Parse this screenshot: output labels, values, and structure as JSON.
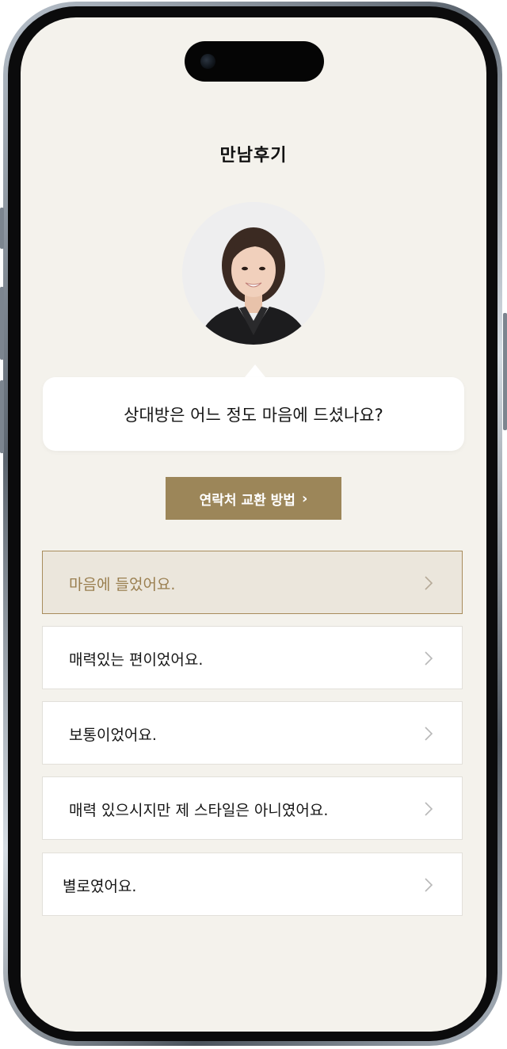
{
  "screen": {
    "title": "만남후기"
  },
  "question": {
    "text": "상대방은 어느 정도 마음에 드셨나요?"
  },
  "contact_button": {
    "label": "연락처 교환 방법",
    "chevron": "›"
  },
  "options": [
    {
      "label": "마음에 들었어요.",
      "selected": true
    },
    {
      "label": "매력있는 편이었어요.",
      "selected": false
    },
    {
      "label": "보통이었어요.",
      "selected": false
    },
    {
      "label": "매력 있으시지만 제 스타일은 아니였어요.",
      "selected": false
    },
    {
      "label": "별로였어요.",
      "selected": false
    }
  ],
  "colors": {
    "background": "#f4f2ec",
    "accent": "#9c8659",
    "selected_bg": "#ebe6dc",
    "selected_border": "#a88c5c",
    "selected_text": "#9a7f50"
  },
  "icons": {
    "option_arrow": "chevron-right-icon",
    "avatar": "profile-photo"
  }
}
